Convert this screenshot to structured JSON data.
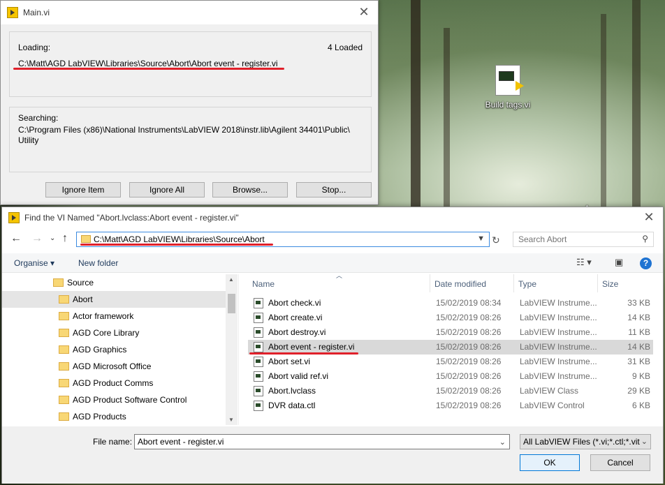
{
  "desktop": {
    "icon_label": "Build tags.vi"
  },
  "loading_dialog": {
    "title": "Main.vi",
    "loading_caption": "Loading:",
    "loaded_count": "4 Loaded",
    "loading_path": "C:\\Matt\\AGD LabVIEW\\Libraries\\Source\\Abort\\Abort event - register.vi",
    "searching_caption": "Searching:",
    "searching_path": "C:\\Program Files (x86)\\National Instruments\\LabVIEW 2018\\instr.lib\\Agilent 34401\\Public\\\nUtility",
    "buttons": {
      "ignore_item": "Ignore Item",
      "ignore_all": "Ignore All",
      "browse": "Browse...",
      "stop": "Stop..."
    }
  },
  "find_dialog": {
    "title": "Find the VI Named \"Abort.lvclass:Abort event - register.vi\"",
    "address": "C:\\Matt\\AGD LabVIEW\\Libraries\\Source\\Abort",
    "search_placeholder": "Search Abort",
    "toolbar": {
      "organise": "Organise",
      "new_folder": "New folder"
    },
    "tree": {
      "parent": "Source",
      "items": [
        "Abort",
        "Actor framework",
        "AGD Core Library",
        "AGD Graphics",
        "AGD Microsoft Office",
        "AGD Product Comms",
        "AGD Product Software Control",
        "AGD Products"
      ]
    },
    "columns": {
      "name": "Name",
      "date": "Date modified",
      "type": "Type",
      "size": "Size"
    },
    "files": [
      {
        "name": "Abort check.vi",
        "date": "15/02/2019 08:34",
        "type": "LabVIEW Instrume...",
        "size": "33 KB"
      },
      {
        "name": "Abort create.vi",
        "date": "15/02/2019 08:26",
        "type": "LabVIEW Instrume...",
        "size": "14 KB"
      },
      {
        "name": "Abort destroy.vi",
        "date": "15/02/2019 08:26",
        "type": "LabVIEW Instrume...",
        "size": "11 KB"
      },
      {
        "name": "Abort event - register.vi",
        "date": "15/02/2019 08:26",
        "type": "LabVIEW Instrume...",
        "size": "14 KB"
      },
      {
        "name": "Abort set.vi",
        "date": "15/02/2019 08:26",
        "type": "LabVIEW Instrume...",
        "size": "31 KB"
      },
      {
        "name": "Abort valid ref.vi",
        "date": "15/02/2019 08:26",
        "type": "LabVIEW Instrume...",
        "size": "9 KB"
      },
      {
        "name": "Abort.lvclass",
        "date": "15/02/2019 08:26",
        "type": "LabVIEW Class",
        "size": "29 KB"
      },
      {
        "name": "DVR data.ctl",
        "date": "15/02/2019 08:26",
        "type": "LabVIEW Control",
        "size": "6 KB"
      }
    ],
    "file_name_label": "File name:",
    "file_name_value": "Abort event - register.vi",
    "file_type": "All LabVIEW Files (*.vi;*.ctl;*.vit;",
    "ok": "OK",
    "cancel": "Cancel"
  },
  "colors": {
    "highlight_underline": "#e0202a",
    "selection_blue": "#cce8ff",
    "folder_yellow": "#f8d775"
  }
}
